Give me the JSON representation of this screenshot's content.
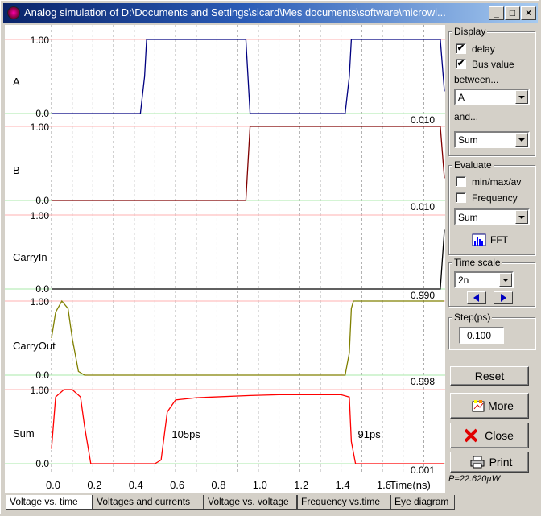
{
  "window": {
    "title": "Analog simulation of D:\\Documents and Settings\\sicard\\Mes documents\\software\\microwi..."
  },
  "title_buttons": [
    "_",
    "□",
    "×"
  ],
  "chart_data": {
    "type": "line",
    "xlabel": "Time(ns)",
    "x_ticks": [
      "0.0",
      "0.2",
      "0.4",
      "0.6",
      "0.8",
      "1.0",
      "1.2",
      "1.4",
      "1.6"
    ],
    "xlim": [
      0,
      1.9
    ],
    "traces": [
      {
        "name": "A",
        "top_label": "1.00",
        "bottom_label": "0.0",
        "end_value": "0.010",
        "color": "#000080",
        "x": [
          0,
          0.43,
          0.45,
          0.46,
          0.47,
          0.94,
          0.95,
          0.96,
          1.42,
          1.44,
          1.45,
          1.46,
          1.88,
          1.9
        ],
        "y": [
          0,
          0,
          0.5,
          1,
          1,
          1,
          0.5,
          0,
          0,
          0.5,
          1,
          1,
          1,
          0.3
        ]
      },
      {
        "name": "B",
        "top_label": "1.00",
        "bottom_label": "0.0",
        "end_value": "0.010",
        "color": "#800000",
        "x": [
          0,
          0.94,
          0.95,
          0.96,
          1.88,
          1.9
        ],
        "y": [
          0,
          0,
          0.5,
          1,
          1,
          0.3
        ]
      },
      {
        "name": "CarryIn",
        "top_label": "1.00",
        "bottom_label": "0.0",
        "end_value": "0.990",
        "color": "#000000",
        "x": [
          0,
          1.88,
          1.9
        ],
        "y": [
          0,
          0,
          0.8
        ]
      },
      {
        "name": "CarryOut",
        "top_label": "1.00",
        "bottom_label": "0.0",
        "end_value": "0.998",
        "color": "#808000",
        "x": [
          0,
          0.02,
          0.05,
          0.08,
          0.1,
          0.13,
          0.16,
          1.42,
          1.44,
          1.45,
          1.46,
          1.9
        ],
        "y": [
          0.5,
          0.85,
          1.0,
          0.9,
          0.5,
          0.05,
          0,
          0,
          0.3,
          0.9,
          1,
          1
        ]
      },
      {
        "name": "Sum",
        "top_label": "1.00",
        "bottom_label": "0.0",
        "end_value": "0.001",
        "color": "#ff0000",
        "x": [
          0,
          0.02,
          0.06,
          0.1,
          0.14,
          0.16,
          0.19,
          0.5,
          0.53,
          0.56,
          0.6,
          0.7,
          0.96,
          1.1,
          1.4,
          1.44,
          1.45,
          1.47,
          1.9
        ],
        "y": [
          0.2,
          0.9,
          1,
          1,
          0.9,
          0.5,
          0,
          0,
          0.05,
          0.7,
          0.86,
          0.89,
          0.92,
          0.93,
          0.93,
          0.9,
          0.3,
          0,
          0
        ]
      }
    ],
    "annotations": [
      {
        "text": "105ps",
        "x": 0.57,
        "trace": "Sum"
      },
      {
        "text": "91ps",
        "x": 1.47,
        "trace": "Sum"
      }
    ]
  },
  "sidebar": {
    "display": {
      "title": "Display",
      "delay_label": "delay",
      "delay_checked": "✔",
      "bus_label": "Bus value",
      "bus_checked": "✔",
      "between_label": "between...",
      "between_value": "A",
      "and_label": "and...",
      "and_value": "Sum"
    },
    "evaluate": {
      "title": "Evaluate",
      "minmax_label": "min/max/av",
      "freq_label": "Frequency",
      "select_value": "Sum",
      "fft_label": "FFT"
    },
    "timescale": {
      "title": "Time scale",
      "value": "2n"
    },
    "step": {
      "title": "Step(ps)",
      "value": "0.100"
    },
    "buttons": {
      "reset": "Reset",
      "more": "More",
      "close": "Close",
      "print": "Print"
    },
    "power": "P=22.620µW"
  },
  "tabs": [
    "Voltage vs. time",
    "Voltages and currents",
    "Voltage vs. voltage",
    "Frequency vs.time",
    "Eye diagram"
  ]
}
